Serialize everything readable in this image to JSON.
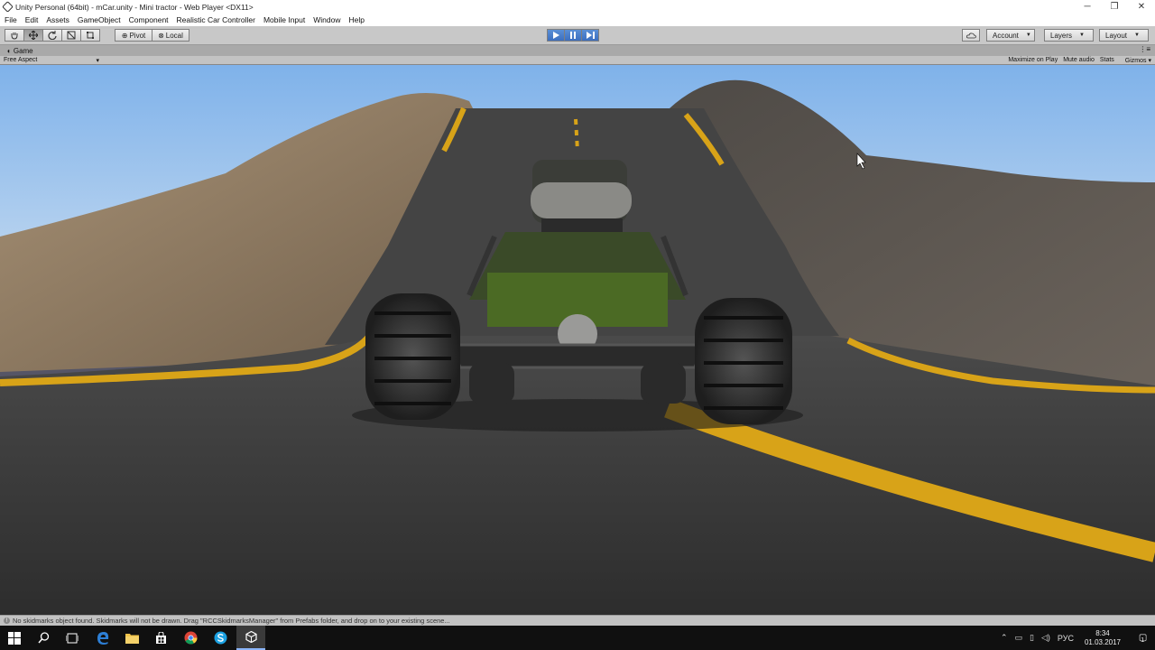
{
  "window": {
    "title": "Unity Personal (64bit) - mCar.unity - Mini tractor - Web Player <DX11>",
    "minimize": "─",
    "maximize": "❐",
    "close": "✕"
  },
  "menu": [
    "File",
    "Edit",
    "Assets",
    "GameObject",
    "Component",
    "Realistic Car Controller",
    "Mobile Input",
    "Window",
    "Help"
  ],
  "toolbar": {
    "pivot_label": "Pivot",
    "local_label": "Local",
    "account_label": "Account",
    "layers_label": "Layers",
    "layout_label": "Layout",
    "play_state": "playing"
  },
  "game_view": {
    "tab_label": "Game",
    "aspect_label": "Free Aspect",
    "maximize_label": "Maximize on Play",
    "mute_label": "Mute audio",
    "stats_label": "Stats",
    "gizmos_label": "Gizmos"
  },
  "console": {
    "message": "No skidmarks object found. Skidmarks will not be drawn. Drag \"RCCSkidmarksManager\" from Prefabs folder, and drop on to your existing scene..."
  },
  "taskbar": {
    "apps": [
      "start",
      "search",
      "task-view",
      "edge",
      "file-explorer",
      "store",
      "chrome",
      "skype",
      "unity"
    ],
    "language": "РУС",
    "time": "8:34",
    "date": "01.03.2017",
    "notifications": "1"
  },
  "colors": {
    "play_blue": "#3c6fbf",
    "road_line": "#d8a318",
    "sky": "#9cc4ee"
  }
}
